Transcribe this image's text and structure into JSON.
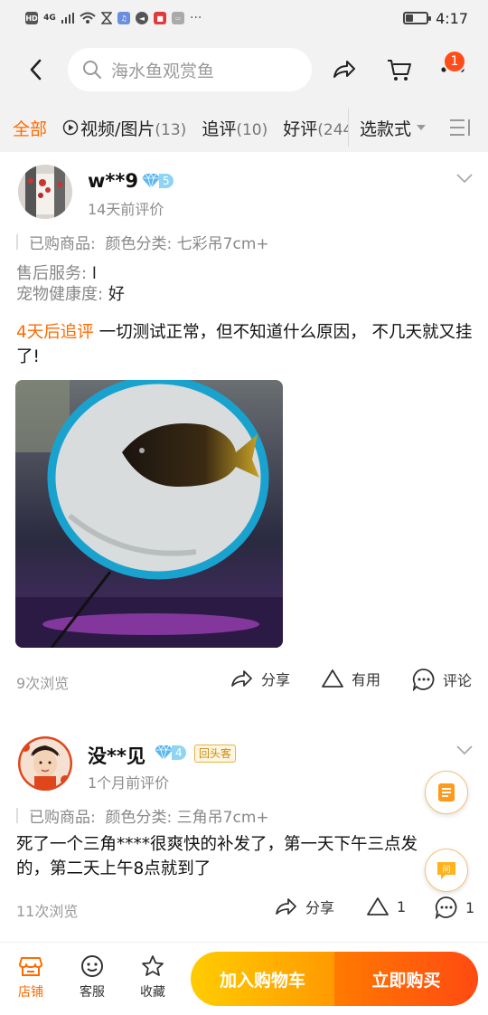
{
  "status_bar": {
    "left_indicators": [
      "HD",
      "4G"
    ],
    "time": "4:17",
    "battery_level": 0.35
  },
  "header": {
    "search_placeholder": "海水鱼观赏鱼",
    "cart_badge": "1",
    "icons": [
      "back-arrow-icon",
      "search-icon",
      "share-icon",
      "cart-icon",
      "more-icon"
    ]
  },
  "filters": {
    "tabs": [
      {
        "label": "全部",
        "count": ""
      },
      {
        "label": "视频/图片",
        "count": "(13)"
      },
      {
        "label": "追评",
        "count": "(10)"
      },
      {
        "label": "好评",
        "count": "(244"
      }
    ],
    "style_select": "选款式"
  },
  "reviews": [
    {
      "username": "w**9",
      "level": "5",
      "time": "14天前评价",
      "sku_label": "已购商品:",
      "sku_value": "颜色分类: 七彩吊7cm+",
      "after_sale_label": "售后服务:",
      "after_sale_value": "l",
      "health_label": "宠物健康度:",
      "health_value": "好",
      "follow_tag": "4天后追评",
      "text": " 一切测试正常，但不知道什么原因， 不几天就又挂了!",
      "views": "9次浏览",
      "share": "分享",
      "useful": "有用",
      "comment": "评论"
    },
    {
      "username": "没**见",
      "level": "4",
      "returning_tag": "回头客",
      "time": "1个月前评价",
      "sku_label": "已购商品:",
      "sku_value": "颜色分类: 三角吊7cm+",
      "text": "死了一个三角****很爽快的补发了，第一天下午三点发的，第二天上午8点就到了",
      "views": "11次浏览",
      "share": "分享",
      "useful": "1",
      "comment": "1"
    }
  ],
  "float_buttons": [
    "list-note-icon",
    "question-icon"
  ],
  "bottom_bar": {
    "shop": "店铺",
    "service": "客服",
    "favorite": "收藏",
    "add_cart": "加入购物车",
    "buy_now": "立即购买"
  },
  "colors": {
    "accent": "#ff6a00",
    "cart_gradient": [
      "#ffcc00",
      "#ff9a00"
    ],
    "buy_gradient": [
      "#ff7a00",
      "#ff4a12"
    ],
    "level_badge": "#8fd4f5"
  }
}
